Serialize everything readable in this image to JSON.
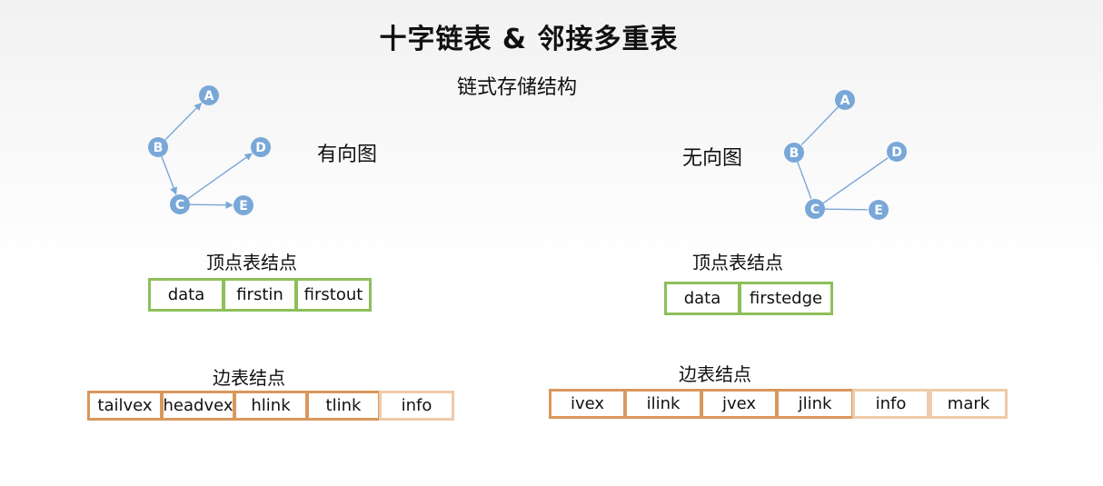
{
  "title": "十字链表 & 邻接多重表",
  "subtitle": "链式存储结构",
  "directed": {
    "label": "有向图",
    "nodes": [
      "A",
      "B",
      "C",
      "D",
      "E"
    ],
    "edges": [
      [
        "B",
        "A"
      ],
      [
        "B",
        "C"
      ],
      [
        "C",
        "D"
      ],
      [
        "C",
        "E"
      ]
    ],
    "vertex_heading": "顶点表结点",
    "vertex_fields": [
      "data",
      "firstin",
      "firstout"
    ],
    "edge_heading": "边表结点",
    "edge_fields": [
      "tailvex",
      "headvex",
      "hlink",
      "tlink",
      "info"
    ]
  },
  "undirected": {
    "label": "无向图",
    "nodes": [
      "A",
      "B",
      "C",
      "D",
      "E"
    ],
    "edges": [
      [
        "A",
        "B"
      ],
      [
        "B",
        "C"
      ],
      [
        "C",
        "D"
      ],
      [
        "C",
        "E"
      ]
    ],
    "vertex_heading": "顶点表结点",
    "vertex_fields": [
      "data",
      "firstedge"
    ],
    "edge_heading": "边表结点",
    "edge_fields": [
      "ivex",
      "ilink",
      "jvex",
      "jlink",
      "info",
      "mark"
    ]
  },
  "colors": {
    "node": "#79a7d8",
    "vertex_border": "#8dbf5a",
    "edge_border": "#d9985c",
    "edge_border_light": "#efcba9"
  }
}
